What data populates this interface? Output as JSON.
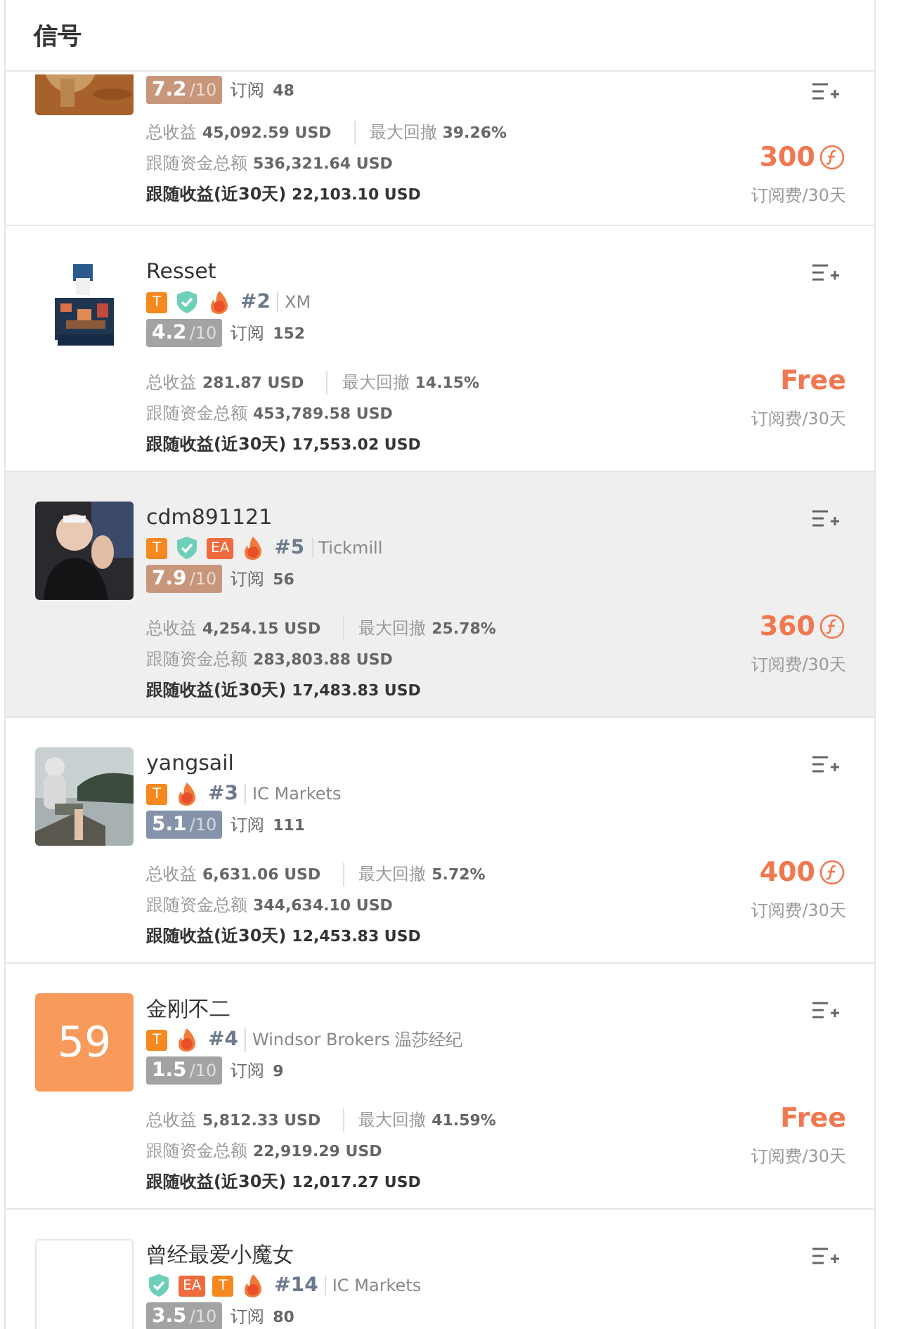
{
  "title": "信号",
  "signals": [
    {
      "selected": false,
      "avatar": {
        "kind": "picture"
      },
      "rating": {
        "score": "7.2",
        "scale": "/10",
        "color": "#c8967a"
      },
      "subs_label": "订阅",
      "subs": "48",
      "stats": [
        {
          "label": "总收益",
          "value": "45,092.59 USD"
        },
        {
          "label": "最大回撤",
          "value": "39.26%"
        }
      ],
      "funds_label": "跟随资金总额",
      "funds": "536,321.64 USD",
      "recent_label": "跟随收益(近30天)",
      "recent": "22,103.10 USD",
      "price": {
        "value": "300",
        "coin": true,
        "unit": "订阅费/30天"
      }
    },
    {
      "selected": false,
      "name": "Resset",
      "avatar": {
        "kind": "picture"
      },
      "badges": [
        {
          "kind": "T",
          "text": "T"
        },
        {
          "kind": "shield"
        },
        {
          "kind": "pk"
        }
      ],
      "rank": "#2",
      "broker": "XM",
      "rating": {
        "score": "4.2",
        "scale": "/10",
        "color": "#a3a3a3"
      },
      "subs_label": "订阅",
      "subs": "152",
      "stats": [
        {
          "label": "总收益",
          "value": "281.87 USD"
        },
        {
          "label": "最大回撤",
          "value": "14.15%"
        }
      ],
      "funds_label": "跟随资金总额",
      "funds": "453,789.58 USD",
      "recent_label": "跟随收益(近30天)",
      "recent": "17,553.02 USD",
      "price": {
        "value": "Free",
        "coin": false,
        "unit": "订阅费/30天"
      }
    },
    {
      "selected": true,
      "name": "cdm891121",
      "avatar": {
        "kind": "picture"
      },
      "badges": [
        {
          "kind": "T",
          "text": "T"
        },
        {
          "kind": "shield"
        },
        {
          "kind": "EA",
          "text": "EA"
        },
        {
          "kind": "pk"
        }
      ],
      "rank": "#5",
      "broker": "Tickmill",
      "rating": {
        "score": "7.9",
        "scale": "/10",
        "color": "#c8967a"
      },
      "subs_label": "订阅",
      "subs": "56",
      "stats": [
        {
          "label": "总收益",
          "value": "4,254.15 USD"
        },
        {
          "label": "最大回撤",
          "value": "25.78%"
        }
      ],
      "funds_label": "跟随资金总额",
      "funds": "283,803.88 USD",
      "recent_label": "跟随收益(近30天)",
      "recent": "17,483.83 USD",
      "price": {
        "value": "360",
        "coin": true,
        "unit": "订阅费/30天"
      }
    },
    {
      "selected": false,
      "name": "yangsail",
      "avatar": {
        "kind": "picture"
      },
      "badges": [
        {
          "kind": "T",
          "text": "T"
        },
        {
          "kind": "pk"
        }
      ],
      "rank": "#3",
      "broker": "IC Markets",
      "rating": {
        "score": "5.1",
        "scale": "/10",
        "color": "#8593aa"
      },
      "subs_label": "订阅",
      "subs": "111",
      "stats": [
        {
          "label": "总收益",
          "value": "6,631.06 USD"
        },
        {
          "label": "最大回撤",
          "value": "5.72%"
        }
      ],
      "funds_label": "跟随资金总额",
      "funds": "344,634.10 USD",
      "recent_label": "跟随收益(近30天)",
      "recent": "12,453.83 USD",
      "price": {
        "value": "400",
        "coin": true,
        "unit": "订阅费/30天"
      }
    },
    {
      "selected": false,
      "name": "金刚不二",
      "avatar": {
        "kind": "number",
        "text": "59"
      },
      "badges": [
        {
          "kind": "T",
          "text": "T"
        },
        {
          "kind": "pk"
        }
      ],
      "rank": "#4",
      "broker": "Windsor Brokers 温莎经纪",
      "rating": {
        "score": "1.5",
        "scale": "/10",
        "color": "#a3a3a3"
      },
      "subs_label": "订阅",
      "subs": "9",
      "stats": [
        {
          "label": "总收益",
          "value": "5,812.33 USD"
        },
        {
          "label": "最大回撤",
          "value": "41.59%"
        }
      ],
      "funds_label": "跟随资金总额",
      "funds": "22,919.29 USD",
      "recent_label": "跟随收益(近30天)",
      "recent": "12,017.27 USD",
      "price": {
        "value": "Free",
        "coin": false,
        "unit": "订阅费/30天"
      }
    },
    {
      "selected": false,
      "name": "曾经最爱小魔女",
      "avatar": {
        "kind": "blank"
      },
      "badges": [
        {
          "kind": "shield"
        },
        {
          "kind": "EA",
          "text": "EA"
        },
        {
          "kind": "T",
          "text": "T"
        },
        {
          "kind": "pk"
        }
      ],
      "rank": "#14",
      "broker": "IC Markets",
      "rating": {
        "score": "3.5",
        "scale": "/10",
        "color": "#a3a3a3"
      },
      "subs_label": "订阅",
      "subs": "80"
    }
  ]
}
